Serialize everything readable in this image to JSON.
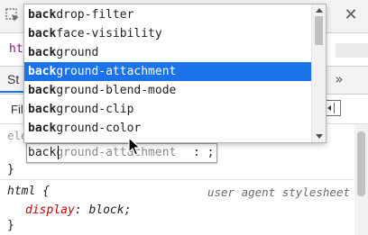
{
  "devtools": {
    "crumb_text": "htm",
    "tab_label": "St",
    "filter_label": "Fil",
    "element_style": "element.style {",
    "close_brace": "}",
    "rule_selector": "html {",
    "rule_origin": "user agent stylesheet",
    "rule_property": "display",
    "rule_colon": ":",
    "rule_value": "block",
    "rule_semicolon": ";",
    "rule_close_brace": "}"
  },
  "editor": {
    "typed": "back",
    "completion": "ground-attachment",
    "tail": ": ;"
  },
  "autocomplete": {
    "query": "back",
    "items": [
      {
        "match": "back",
        "rest": "drop-filter"
      },
      {
        "match": "back",
        "rest": "face-visibility"
      },
      {
        "match": "back",
        "rest": "ground"
      },
      {
        "match": "back",
        "rest": "ground-attachment"
      },
      {
        "match": "back",
        "rest": "ground-blend-mode"
      },
      {
        "match": "back",
        "rest": "ground-clip"
      },
      {
        "match": "back",
        "rest": "ground-color"
      }
    ],
    "selected_index": 3
  },
  "icons": {
    "close": "close-icon",
    "more": "chevron-double-right-icon",
    "inspect": "inspect-element-icon",
    "sidebar_toggle": "toggle-sidebar-icon"
  },
  "colors": {
    "selected_bg": "#1a73e8",
    "property_red": "#c80000",
    "crumb_tag": "#881280"
  }
}
